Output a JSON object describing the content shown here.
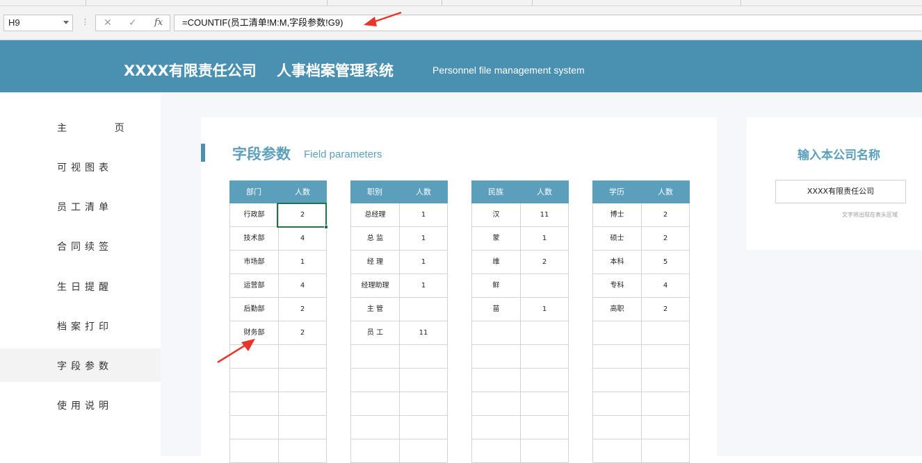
{
  "formula_bar": {
    "name_box": "H9",
    "formula": "=COUNTIF(员工清单!M:M,字段参数!G9)",
    "cancel_icon": "close-icon",
    "enter_icon": "check-icon",
    "fx_label": "fx"
  },
  "header": {
    "title": "XXXX有限责任公司    人事档案管理系统",
    "subtitle": "Personnel file management system",
    "background": "#4a91b1"
  },
  "sidebar": {
    "items": [
      {
        "label": "主      页",
        "active": false
      },
      {
        "label": "可视图表",
        "active": false
      },
      {
        "label": "员工清单",
        "active": false
      },
      {
        "label": "合同续签",
        "active": false
      },
      {
        "label": "生日提醒",
        "active": false
      },
      {
        "label": "档案打印",
        "active": false
      },
      {
        "label": "字段参数",
        "active": true
      },
      {
        "label": "使用说明",
        "active": false
      }
    ]
  },
  "section": {
    "title": "字段参数",
    "subtitle": "Field parameters",
    "accent": "#5b9fbd"
  },
  "tables": [
    {
      "headers": [
        "部门",
        "人数"
      ],
      "rows": [
        [
          "行政部",
          "2"
        ],
        [
          "技术部",
          "4"
        ],
        [
          "市场部",
          "1"
        ],
        [
          "运营部",
          "4"
        ],
        [
          "后勤部",
          "2"
        ],
        [
          "财务部",
          "2"
        ],
        [
          "",
          ""
        ],
        [
          "",
          ""
        ],
        [
          "",
          ""
        ],
        [
          "",
          ""
        ],
        [
          "",
          ""
        ]
      ]
    },
    {
      "headers": [
        "职别",
        "人数"
      ],
      "rows": [
        [
          "总经理",
          "1"
        ],
        [
          "总  监",
          "1"
        ],
        [
          "经  理",
          "1"
        ],
        [
          "经理助理",
          "1"
        ],
        [
          "主  管",
          ""
        ],
        [
          "员  工",
          "11"
        ],
        [
          "",
          ""
        ],
        [
          "",
          ""
        ],
        [
          "",
          ""
        ],
        [
          "",
          ""
        ],
        [
          "",
          ""
        ]
      ]
    },
    {
      "headers": [
        "民族",
        "人数"
      ],
      "rows": [
        [
          "汉",
          "11"
        ],
        [
          "蒙",
          "1"
        ],
        [
          "维",
          "2"
        ],
        [
          "鲜",
          ""
        ],
        [
          "苗",
          "1"
        ],
        [
          "",
          ""
        ],
        [
          "",
          ""
        ],
        [
          "",
          ""
        ],
        [
          "",
          ""
        ],
        [
          "",
          ""
        ],
        [
          "",
          ""
        ]
      ]
    },
    {
      "headers": [
        "学历",
        "人数"
      ],
      "rows": [
        [
          "博士",
          "2"
        ],
        [
          "硕士",
          "2"
        ],
        [
          "本科",
          "5"
        ],
        [
          "专科",
          "4"
        ],
        [
          "高职",
          "2"
        ],
        [
          "",
          ""
        ],
        [
          "",
          ""
        ],
        [
          "",
          ""
        ],
        [
          "",
          ""
        ],
        [
          "",
          ""
        ],
        [
          "",
          ""
        ]
      ]
    }
  ],
  "company_panel": {
    "title": "输入本公司名称",
    "value": "XXXX有限责任公司",
    "hint": "文字将出现在表头区域"
  },
  "annotations": {
    "arrow_color": "#e8342b"
  }
}
